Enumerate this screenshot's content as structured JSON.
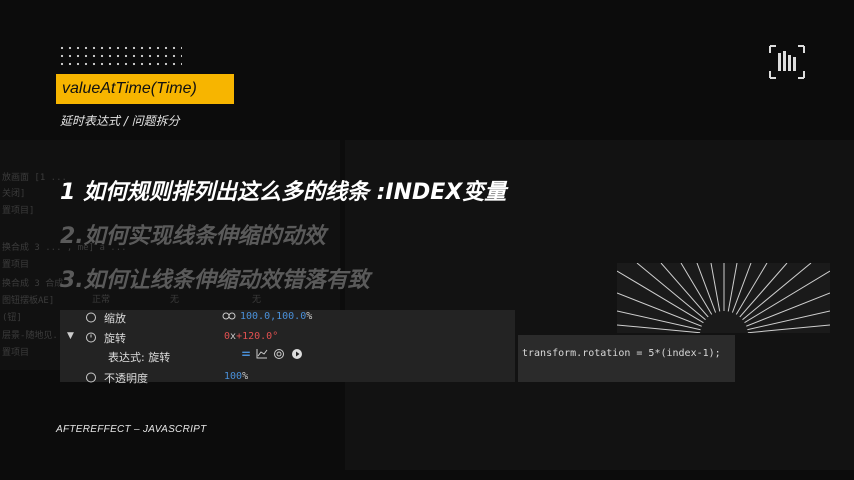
{
  "slide": {
    "title_tag": "valueAtTime(Time)",
    "subtitle": "延时表达式 / 问题拆分",
    "headings": [
      "1 如何规则排列出这么多的线条 :INDEX变量",
      "2.如何实现线条伸缩的动效",
      "3.如何让线条伸缩动效错落有致"
    ],
    "footer": "AFTEREFFECT – JAVASCRIPT"
  },
  "ae_panel": {
    "scale_label": "缩放",
    "scale_value": "100.0,100.0",
    "scale_unit": "%",
    "rotation_label": "旋转",
    "rotation_value_prefix": "0",
    "rotation_value_x": "x",
    "rotation_value_deg": "+120.0",
    "rotation_unit": "°",
    "expression_label": "表达式: 旋转",
    "opacity_label": "不透明度",
    "opacity_value": "100",
    "opacity_unit": "%",
    "expression_code": "transform.rotation = 5*(index-1);",
    "mode_normal": "正常",
    "mode_none_1": "无",
    "mode_none_2": "无"
  },
  "ghost_layers": [
    "放画面 [1 ...",
    "关闭]",
    "置项目]",
    "换合成 3 ... , me] a ...",
    "置项目",
    "换合成 3 合成",
    "图钮摆板AE]",
    "(钮]",
    "层景-随地见...",
    "置项目"
  ],
  "colors": {
    "accent": "#f7b500",
    "value_blue": "#4a90d9",
    "value_red": "#e05050"
  }
}
